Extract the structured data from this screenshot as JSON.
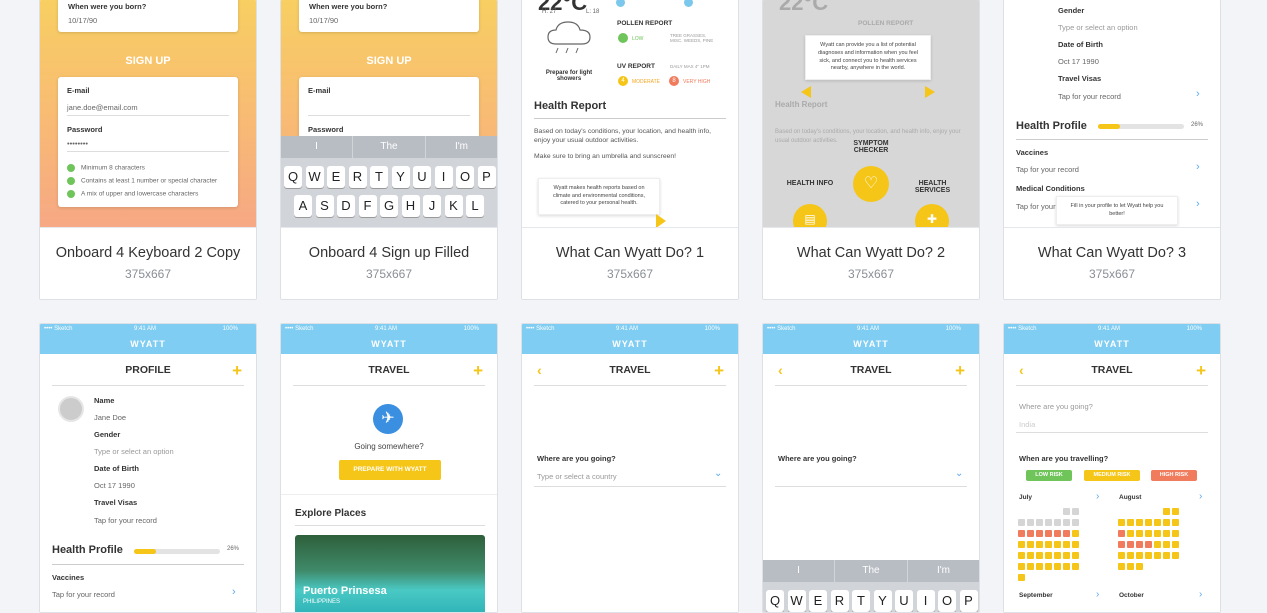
{
  "cards": [
    {
      "title": "Onboard 4 Keyboard 2 Copy",
      "size": "375x667"
    },
    {
      "title": "Onboard 4 Sign up Filled",
      "size": "375x667"
    },
    {
      "title": "What Can Wyatt Do? 1",
      "size": "375x667"
    },
    {
      "title": "What Can Wyatt Do? 2",
      "size": "375x667"
    },
    {
      "title": "What Can Wyatt Do? 3",
      "size": "375x667"
    }
  ],
  "signup": {
    "born_q": "When were you born?",
    "born_val": "10/17/90",
    "button": "SIGN UP",
    "email_label": "E-mail",
    "email_val": "jane.doe@email.com",
    "password_label": "Password",
    "password_val": "••••••••",
    "rules": [
      "Minimum 8 characters",
      "Contains at least 1 number or special character",
      "A mix of upper and lowercase characters"
    ]
  },
  "keyboard": {
    "suggestions": [
      "I",
      "The",
      "I'm"
    ],
    "row1": [
      "Q",
      "W",
      "E",
      "R",
      "T",
      "Y",
      "U",
      "I",
      "O",
      "P"
    ],
    "row2": [
      "A",
      "S",
      "D",
      "F",
      "G",
      "H",
      "J",
      "K",
      "L"
    ]
  },
  "wyatt1": {
    "hi": "H: 27",
    "lo": "L: 18",
    "pollen": "POLLEN REPORT",
    "low": "LOW",
    "pollen_note": "TREE GRASSES, MISC. WEEDS, PINE",
    "uv": "UV REPORT",
    "uv_max": "DAILY MAX 4\" 1PM",
    "moderate": "MODERATE",
    "very_high": "VERY HIGH",
    "prepare": "Prepare for light showers",
    "health_report": "Health Report",
    "body": "Based on today's conditions, your location, and health info, enjoy your usual outdoor activities.",
    "bring": "Make sure to bring an umbrella and sunscreen!",
    "tip": "Wyatt makes health reports based on climate and environmental conditions, catered to your personal health."
  },
  "wyatt2": {
    "tip": "Wyatt can provide you a list of potential diagnoses and information when you feel sick, and connect you to health services nearby, anywhere in the world.",
    "symptom": "SYMPTOM CHECKER",
    "health_info": "HEALTH INFO",
    "health_services": "HEALTH SERVICES"
  },
  "wyatt3": {
    "gender": "Gender",
    "gender_ph": "Type or select an option",
    "dob": "Date of Birth",
    "dob_val": "Oct 17 1990",
    "visas": "Travel Visas",
    "visas_val": "Tap for your record",
    "health_profile": "Health Profile",
    "pct": "26%",
    "pct_fill": 0.26,
    "vaccines": "Vaccines",
    "vaccines_val": "Tap for your record",
    "medical": "Medical Conditions",
    "medical_val": "Tap for your",
    "tip": "Fill in your profile to let Wyatt help you better!"
  },
  "status": {
    "carrier": "•••• Sketch",
    "time": "9:41 AM",
    "battery": "100%"
  },
  "app_name": "WYATT",
  "profile": {
    "title": "PROFILE",
    "name_label": "Name",
    "name_val": "Jane Doe",
    "gender": "Gender",
    "gender_ph": "Type or select an option",
    "dob": "Date of Birth",
    "dob_val": "Oct 17 1990",
    "visas": "Travel Visas",
    "visas_val": "Tap for your record",
    "health_profile": "Health Profile",
    "pct": "26%",
    "pct_fill": 0.26,
    "vaccines": "Vaccines",
    "vaccines_val": "Tap for your record"
  },
  "travel1": {
    "title": "TRAVEL",
    "going": "Going somewhere?",
    "button": "PREPARE WITH WYATT",
    "explore": "Explore Places",
    "place": "Puerto Prinsesa",
    "country": "PHILIPPINES"
  },
  "travel2": {
    "title": "TRAVEL",
    "where": "Where are you going?",
    "placeholder": "Type or select a country"
  },
  "travel3": {
    "title": "TRAVEL",
    "where": "Where are you going?"
  },
  "travel4": {
    "title": "TRAVEL",
    "where": "Where are you going?",
    "where_val": "India",
    "when": "When are you travelling?",
    "low": "LOW RISK",
    "medium": "MEDIUM RISK",
    "high": "HIGH RISK",
    "july": "July",
    "august": "August",
    "september": "September",
    "october": "October"
  }
}
